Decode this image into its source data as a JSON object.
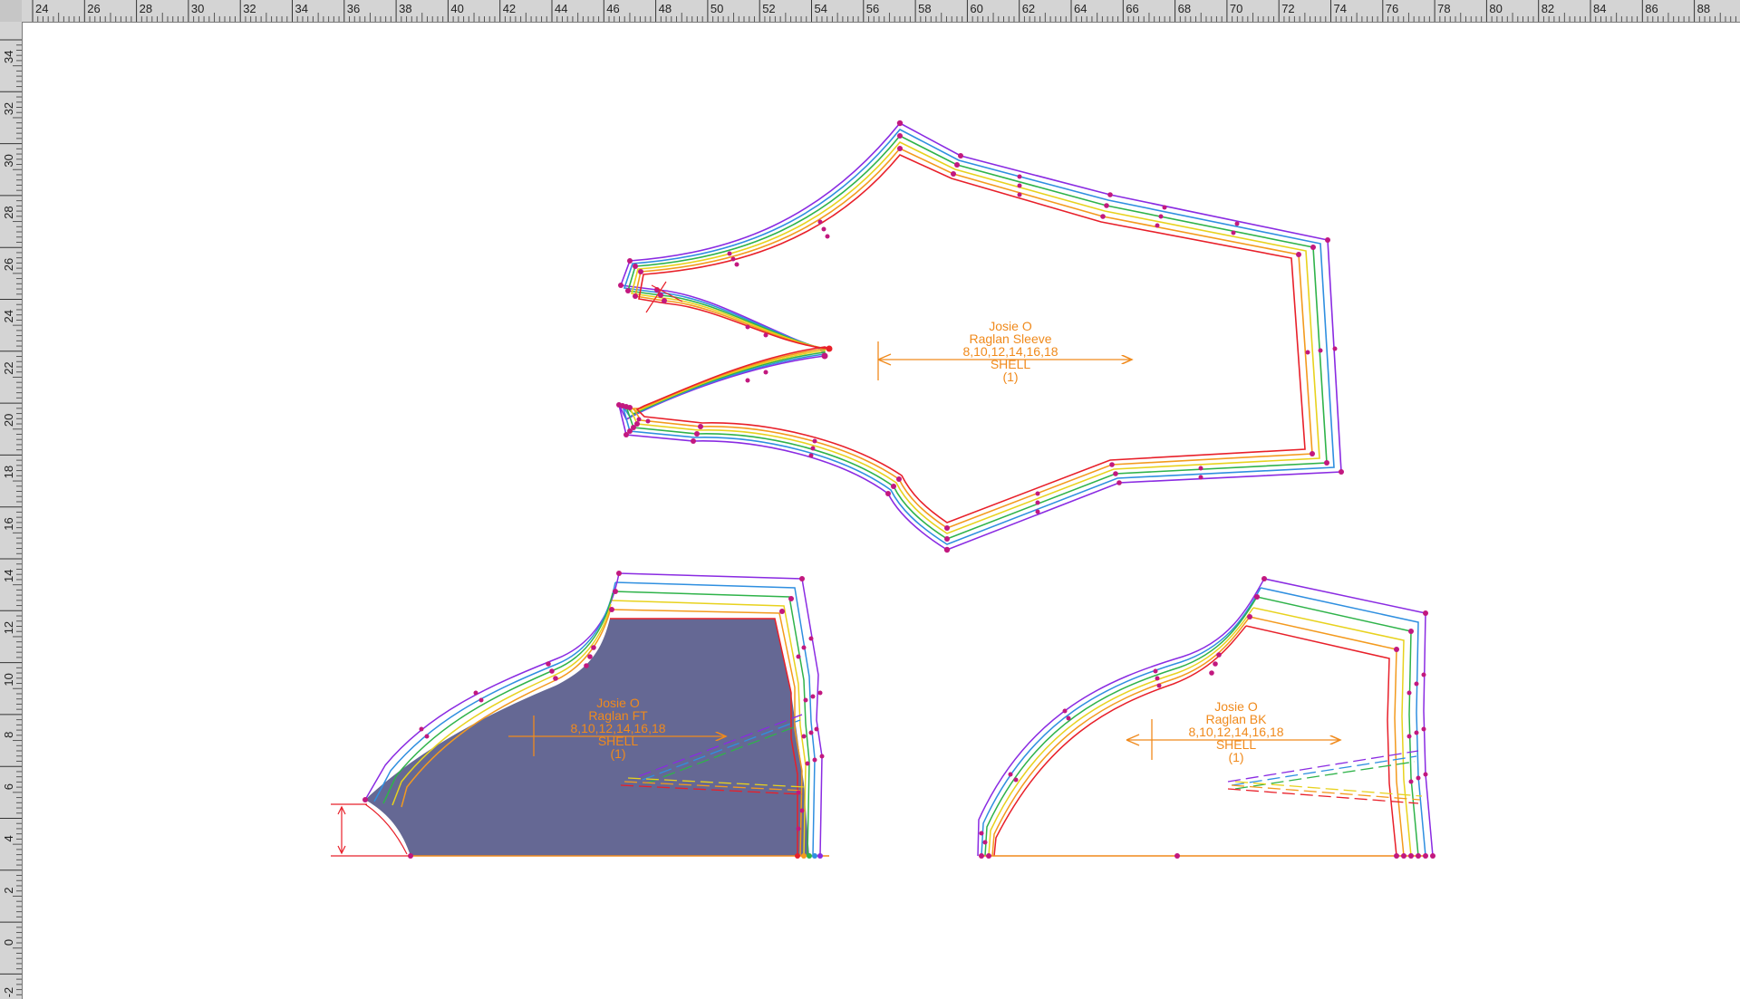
{
  "app": {
    "view": "pattern-design-workspace"
  },
  "rulers": {
    "horizontal_labels": [
      "24",
      "26",
      "28",
      "30",
      "32",
      "34",
      "36",
      "38",
      "40",
      "42",
      "44",
      "46",
      "48",
      "50",
      "52",
      "54",
      "56",
      "58",
      "60",
      "62",
      "64",
      "66",
      "68",
      "70",
      "72",
      "74",
      "76",
      "78",
      "80",
      "82",
      "84",
      "86",
      "88"
    ],
    "vertical_labels": [
      "34",
      "32",
      "30",
      "28",
      "26",
      "24",
      "22",
      "20",
      "18",
      "16",
      "14",
      "12",
      "10",
      "8",
      "6",
      "4",
      "2",
      "0",
      "-2"
    ]
  },
  "colors": {
    "ruler_bg": "#d4d4d4",
    "canvas_bg": "#ffffff",
    "annotation_orange": "#f08a1c",
    "point_magenta": "#c2187f",
    "selected_fill": "#656894",
    "measure_red": "#e8202a",
    "size_lines": [
      "#e8202a",
      "#f39a1e",
      "#e8d21e",
      "#2fb34a",
      "#2f8fe0",
      "#8a2be2"
    ]
  },
  "pieces": {
    "sleeve": {
      "line1": "Josie O",
      "line2": "Raglan Sleeve",
      "line3": "8,10,12,14,16,18",
      "line4": "SHELL",
      "line5": "(1)"
    },
    "front": {
      "line1": "Josie O",
      "line2": "Raglan FT",
      "line3": "8,10,12,14,16,18",
      "line4": "SHELL",
      "line5": "(1)"
    },
    "back": {
      "line1": "Josie O",
      "line2": "Raglan BK",
      "line3": "8,10,12,14,16,18",
      "line4": "SHELL",
      "line5": "(1)"
    }
  }
}
